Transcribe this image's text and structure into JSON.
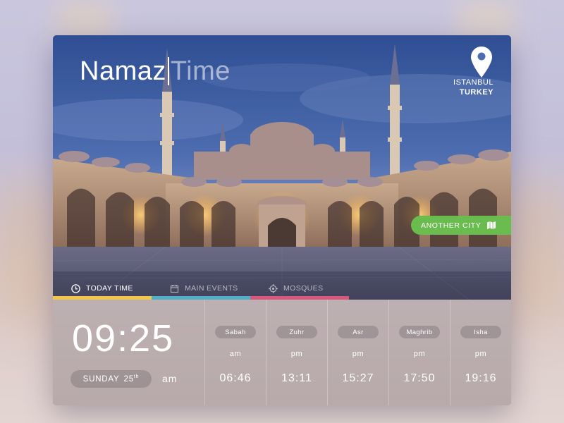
{
  "app": {
    "title_part1": "Namaz",
    "title_part2": "Time"
  },
  "location": {
    "city": "ISTANBUL",
    "country": "TURKEY",
    "icon": "location-pin-icon"
  },
  "another_city": {
    "label": "ANOTHER CITY",
    "icon": "map-icon",
    "color": "#6abc4e"
  },
  "tabs": [
    {
      "label": "TODAY TIME",
      "icon": "clock-icon",
      "active": true,
      "color": "#f2c646"
    },
    {
      "label": "MAIN EVENTS",
      "icon": "calendar-icon",
      "active": false,
      "color": "#4fb0c6"
    },
    {
      "label": "MOSQUES",
      "icon": "target-icon",
      "active": false,
      "color": "#d9577c"
    }
  ],
  "current": {
    "time": "09:25",
    "day": "SUNDAY",
    "date": "25",
    "date_suffix": "th",
    "ampm": "am"
  },
  "prayers": [
    {
      "name": "Sabah",
      "ampm": "am",
      "time": "06:46"
    },
    {
      "name": "Zuhr",
      "ampm": "pm",
      "time": "13:11"
    },
    {
      "name": "Asr",
      "ampm": "pm",
      "time": "15:27"
    },
    {
      "name": "Maghrib",
      "ampm": "pm",
      "time": "17:50"
    },
    {
      "name": "Isha",
      "ampm": "pm",
      "time": "19:16"
    }
  ]
}
